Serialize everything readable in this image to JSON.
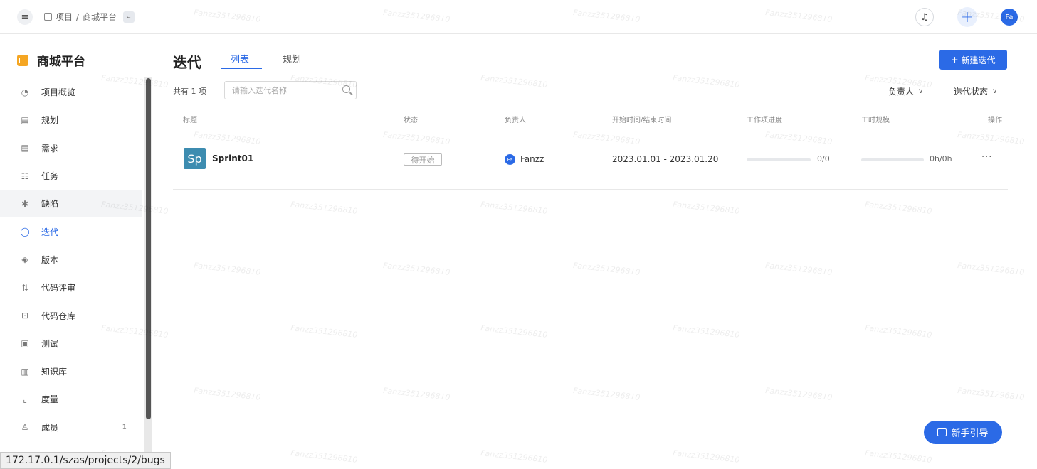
{
  "topbar": {
    "menu_icon": "menu-icon",
    "breadcrumb": {
      "root": "项目",
      "separator": "/",
      "project": "商城平台"
    },
    "avatar_text": "Fa"
  },
  "sidebar": {
    "project_name": "商城平台",
    "items": [
      {
        "label": "项目概览",
        "icon": "dashboard-icon",
        "glyph": "◔",
        "state": "normal",
        "count": ""
      },
      {
        "label": "规划",
        "icon": "calendar-icon",
        "glyph": "▤",
        "state": "normal",
        "count": ""
      },
      {
        "label": "需求",
        "icon": "requirement-icon",
        "glyph": "▤",
        "state": "normal",
        "count": ""
      },
      {
        "label": "任务",
        "icon": "task-icon",
        "glyph": "☷",
        "state": "normal",
        "count": ""
      },
      {
        "label": "缺陷",
        "icon": "bug-icon",
        "glyph": "✱",
        "state": "hover",
        "count": ""
      },
      {
        "label": "迭代",
        "icon": "iteration-icon",
        "glyph": "◯",
        "state": "active",
        "count": ""
      },
      {
        "label": "版本",
        "icon": "layers-icon",
        "glyph": "◈",
        "state": "normal",
        "count": ""
      },
      {
        "label": "代码评审",
        "icon": "pull-request-icon",
        "glyph": "⇅",
        "state": "normal",
        "count": ""
      },
      {
        "label": "代码仓库",
        "icon": "code-icon",
        "glyph": "⊡",
        "state": "normal",
        "count": ""
      },
      {
        "label": "测试",
        "icon": "test-icon",
        "glyph": "▣",
        "state": "normal",
        "count": ""
      },
      {
        "label": "知识库",
        "icon": "book-icon",
        "glyph": "▥",
        "state": "normal",
        "count": ""
      },
      {
        "label": "度量",
        "icon": "chart-icon",
        "glyph": "⌞",
        "state": "normal",
        "count": ""
      },
      {
        "label": "成员",
        "icon": "members-icon",
        "glyph": "♙",
        "state": "normal",
        "count": "1"
      }
    ]
  },
  "status_bar": {
    "url": "172.17.0.1/szas/projects/2/bugs"
  },
  "main": {
    "title": "迭代",
    "tabs": [
      {
        "label": "列表",
        "active": true
      },
      {
        "label": "规划",
        "active": false
      }
    ],
    "new_button": "新建迭代",
    "count_text": "共有 1 项",
    "search_placeholder": "请输入迭代名称",
    "filters": {
      "owner": "负责人",
      "status": "迭代状态"
    },
    "columns": {
      "title": "标题",
      "status": "状态",
      "owner": "负责人",
      "time": "开始时间/结束时间",
      "work_progress": "工作项进度",
      "hours": "工时规模",
      "actions": "操作"
    },
    "rows": [
      {
        "badge": "Sp",
        "title": "Sprint01",
        "status": "待开始",
        "owner_avatar": "Fa",
        "owner": "Fanzz",
        "dates": "2023.01.01  -  2023.01.20",
        "work_progress": 0,
        "work_progress_text": "0/0",
        "hours_progress": 0,
        "hours_text": "0h/0h",
        "actions": "···"
      }
    ],
    "guide_button": "新手引导"
  },
  "watermark_text": "Fanzz351296810",
  "colors": {
    "primary": "#2b6ae6",
    "project_icon": "#f5a623",
    "badge": "#3d8cb0"
  }
}
